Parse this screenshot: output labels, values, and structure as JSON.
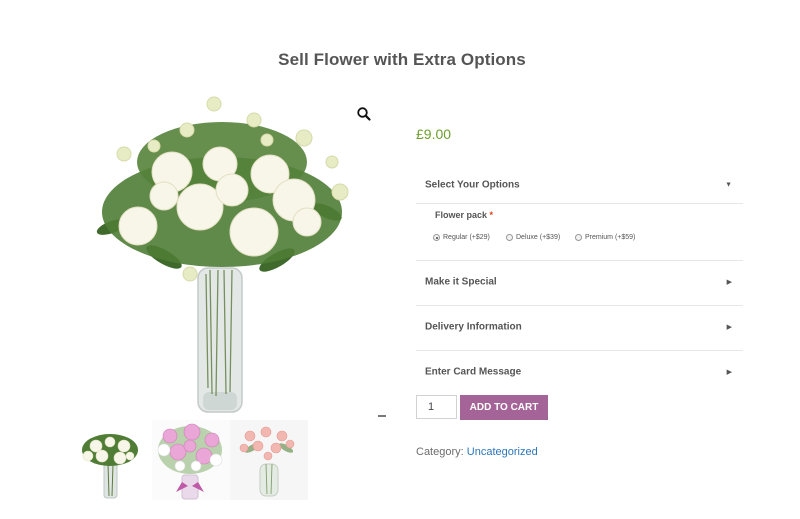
{
  "product": {
    "title": "Sell Flower with Extra Options",
    "price": "£9.00",
    "category_label": "Category:",
    "category_link": "Uncategorized"
  },
  "gallery": {
    "zoom_icon": "magnifier-icon",
    "thumbnails": [
      "white-peony-bouquet",
      "pink-lily-bouquet",
      "pink-rose-bouquet"
    ]
  },
  "options": {
    "sections": [
      {
        "label": "Select Your Options",
        "expanded": true
      },
      {
        "label": "Make it Special",
        "expanded": false
      },
      {
        "label": "Delivery Information",
        "expanded": false
      },
      {
        "label": "Enter Card Message",
        "expanded": false
      }
    ],
    "flower_pack": {
      "label": "Flower pack",
      "required_mark": "*",
      "choices": [
        "Regular (+$29)",
        "Deluxe (+$39)",
        "Premium (+$59)"
      ],
      "selected": "Regular (+$29)"
    }
  },
  "cart": {
    "quantity": "1",
    "add_label": "ADD TO CART"
  },
  "colors": {
    "price": "#6c9f2f",
    "button": "#a46497",
    "link": "#2c76b9"
  }
}
